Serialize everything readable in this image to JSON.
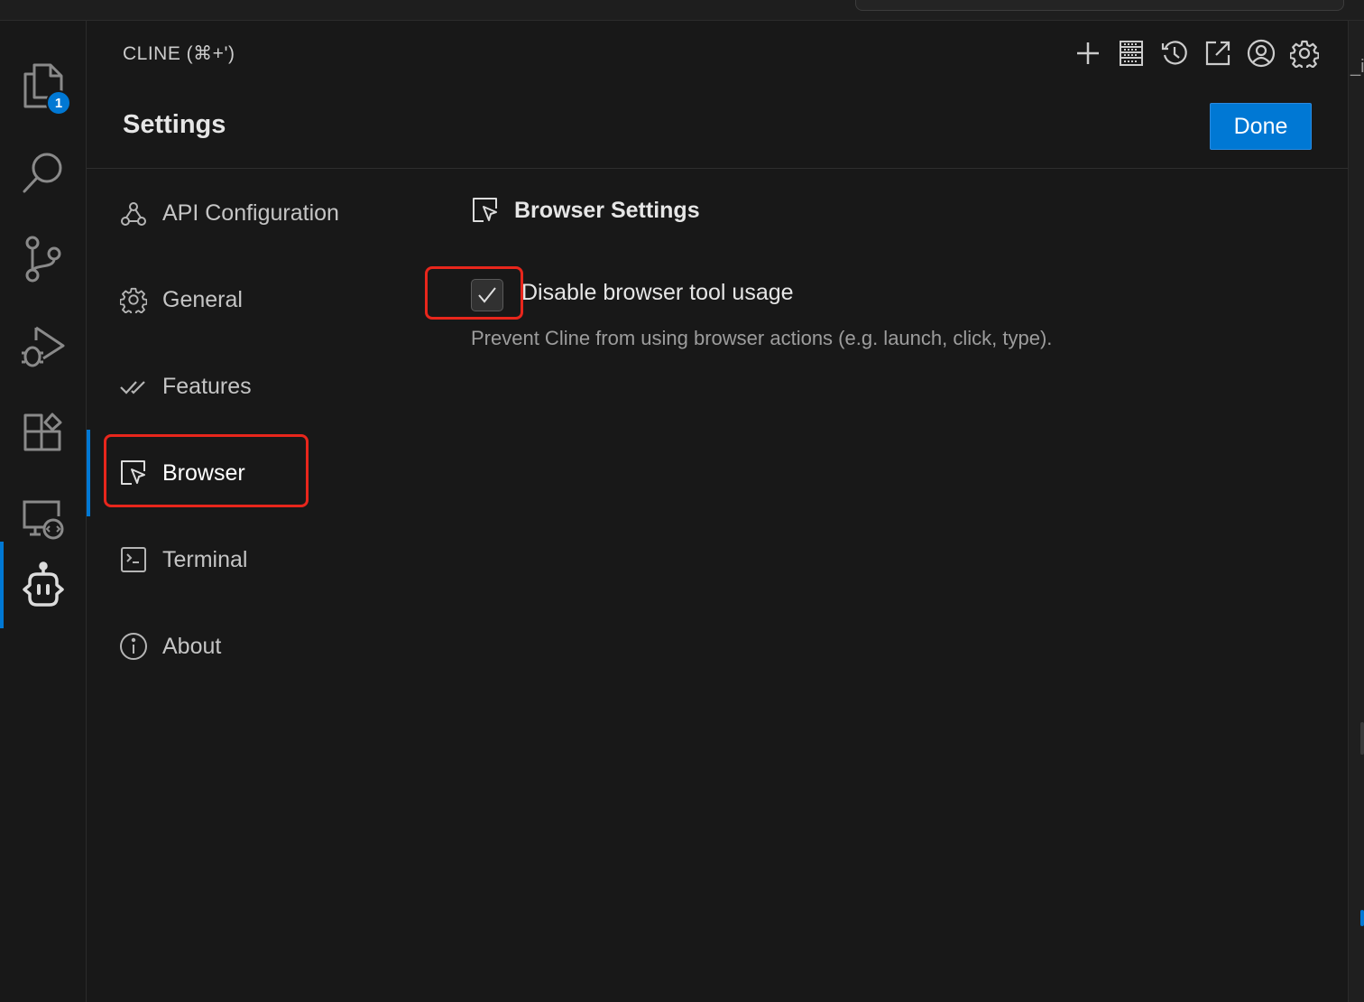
{
  "panel": {
    "title": "CLINE (⌘+')",
    "header_icons": [
      "plus-icon",
      "server-icon",
      "history-icon",
      "popout-icon",
      "account-icon",
      "settings-gear-icon"
    ]
  },
  "activity_bar": {
    "items": [
      {
        "icon": "explorer-icon",
        "badge": "1"
      },
      {
        "icon": "search-icon"
      },
      {
        "icon": "source-control-icon"
      },
      {
        "icon": "run-debug-icon"
      },
      {
        "icon": "extensions-icon"
      },
      {
        "icon": "remote-explorer-icon"
      },
      {
        "icon": "cline-robot-icon",
        "active": true
      }
    ]
  },
  "settings": {
    "title": "Settings",
    "done_label": "Done",
    "nav": [
      {
        "label": "API Configuration",
        "icon": "webhook-icon"
      },
      {
        "label": "General",
        "icon": "gear-icon"
      },
      {
        "label": "Features",
        "icon": "check-all-icon"
      },
      {
        "label": "Browser",
        "icon": "browser-cursor-icon",
        "active": true
      },
      {
        "label": "Terminal",
        "icon": "terminal-icon"
      },
      {
        "label": "About",
        "icon": "info-icon"
      }
    ],
    "section": {
      "title": "Browser Settings",
      "checkbox": {
        "label": "Disable browser tool usage",
        "checked": true,
        "description": "Prevent Cline from using browser actions (e.g. launch, click, type)."
      }
    }
  },
  "right_edge_fragment": "_i",
  "colors": {
    "accent": "#0078d4",
    "highlight": "#e8261c",
    "background": "#181818"
  }
}
